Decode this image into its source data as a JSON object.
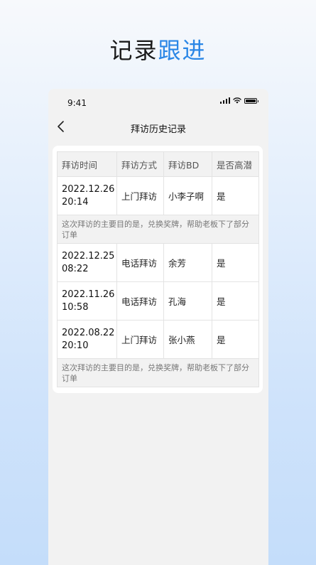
{
  "hero": {
    "title_main": "记录",
    "title_accent": "跟进"
  },
  "status": {
    "time": "9:41"
  },
  "nav": {
    "title": "拜访历史记录"
  },
  "table": {
    "headers": [
      "拜访时间",
      "拜访方式",
      "拜访BD",
      "是否高潜"
    ],
    "rows": [
      {
        "time_date": "2022.12.26",
        "time_clock": "20:14",
        "method": "上门拜访",
        "bd": "小李子啊",
        "potential": "是",
        "note": "这次拜访的主要目的是，兑换奖牌，帮助老板下了部分订单"
      },
      {
        "time_date": "2022.12.25",
        "time_clock": "08:22",
        "method": "电话拜访",
        "bd": "余芳",
        "potential": "是"
      },
      {
        "time_date": "2022.11.26",
        "time_clock": "10:58",
        "method": "电话拜访",
        "bd": "孔海",
        "potential": "是"
      },
      {
        "time_date": "2022.08.22",
        "time_clock": "20:10",
        "method": "上门拜访",
        "bd": "张小燕",
        "potential": "是",
        "note": "这次拜访的主要目的是，兑换奖牌，帮助老板下了部分订单"
      }
    ]
  },
  "colors": {
    "accent": "#2a86e6",
    "page_bg_top": "#f7f9fc",
    "page_bg_bottom": "#c4ddfa"
  },
  "icons": {
    "back": "chevron-left-icon",
    "signal": "signal-icon",
    "wifi": "wifi-icon",
    "battery": "battery-icon"
  }
}
